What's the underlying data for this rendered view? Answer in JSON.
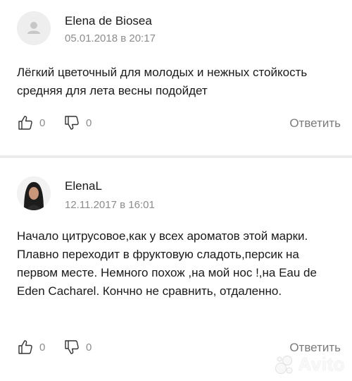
{
  "comments": [
    {
      "author": "Elena de Biosea",
      "date": "05.01.2018 в 20:17",
      "text": "Лёгкий цветочный для молодых и нежных стойкость средняя для лета весны подойдет",
      "likes": "0",
      "dislikes": "0",
      "reply_label": "Ответить",
      "avatar_icon": "user-placeholder-icon"
    },
    {
      "author": "ElenaL",
      "date": "12.11.2017 в 16:01",
      "text": "Начало цитрусовое,как у всех ароматов этой марки. Плавно переходит в фруктовую сладоть,персик на первом месте. Немного похож ,на мой нос !,на Eau de Eden Cacharel. Кончно не сравнить, отдаленно.",
      "likes": "0",
      "dislikes": "0",
      "reply_label": "Ответить",
      "avatar_icon": "user-photo"
    }
  ],
  "watermark": {
    "text": "Avito"
  }
}
